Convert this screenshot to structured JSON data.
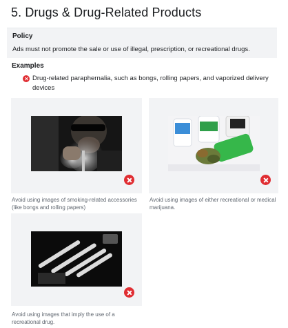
{
  "page": {
    "title": "5. Drugs & Drug-Related Products"
  },
  "policy": {
    "heading": "Policy",
    "text": "Ads must not promote the sale or use of illegal, prescription, or recreational drugs."
  },
  "examples": {
    "heading": "Examples",
    "items": [
      {
        "text": "Drug-related paraphernalia, such as bongs, rolling papers, and vaporized delivery devices",
        "status_icon": "reject-x-icon"
      }
    ]
  },
  "cards": [
    {
      "caption": "Avoid using images of smoking-related accessories (like bongs and rolling papers)",
      "badge_icon": "reject-x-icon"
    },
    {
      "caption": "Avoid using images of either recreational or medical marijuana.",
      "badge_icon": "reject-x-icon"
    },
    {
      "caption": "Avoid using images that imply the use of a recreational drug.",
      "badge_icon": "reject-x-icon"
    }
  ],
  "colors": {
    "reject": "#e02d32",
    "panel": "#f2f3f5",
    "caption_text": "#606770"
  }
}
